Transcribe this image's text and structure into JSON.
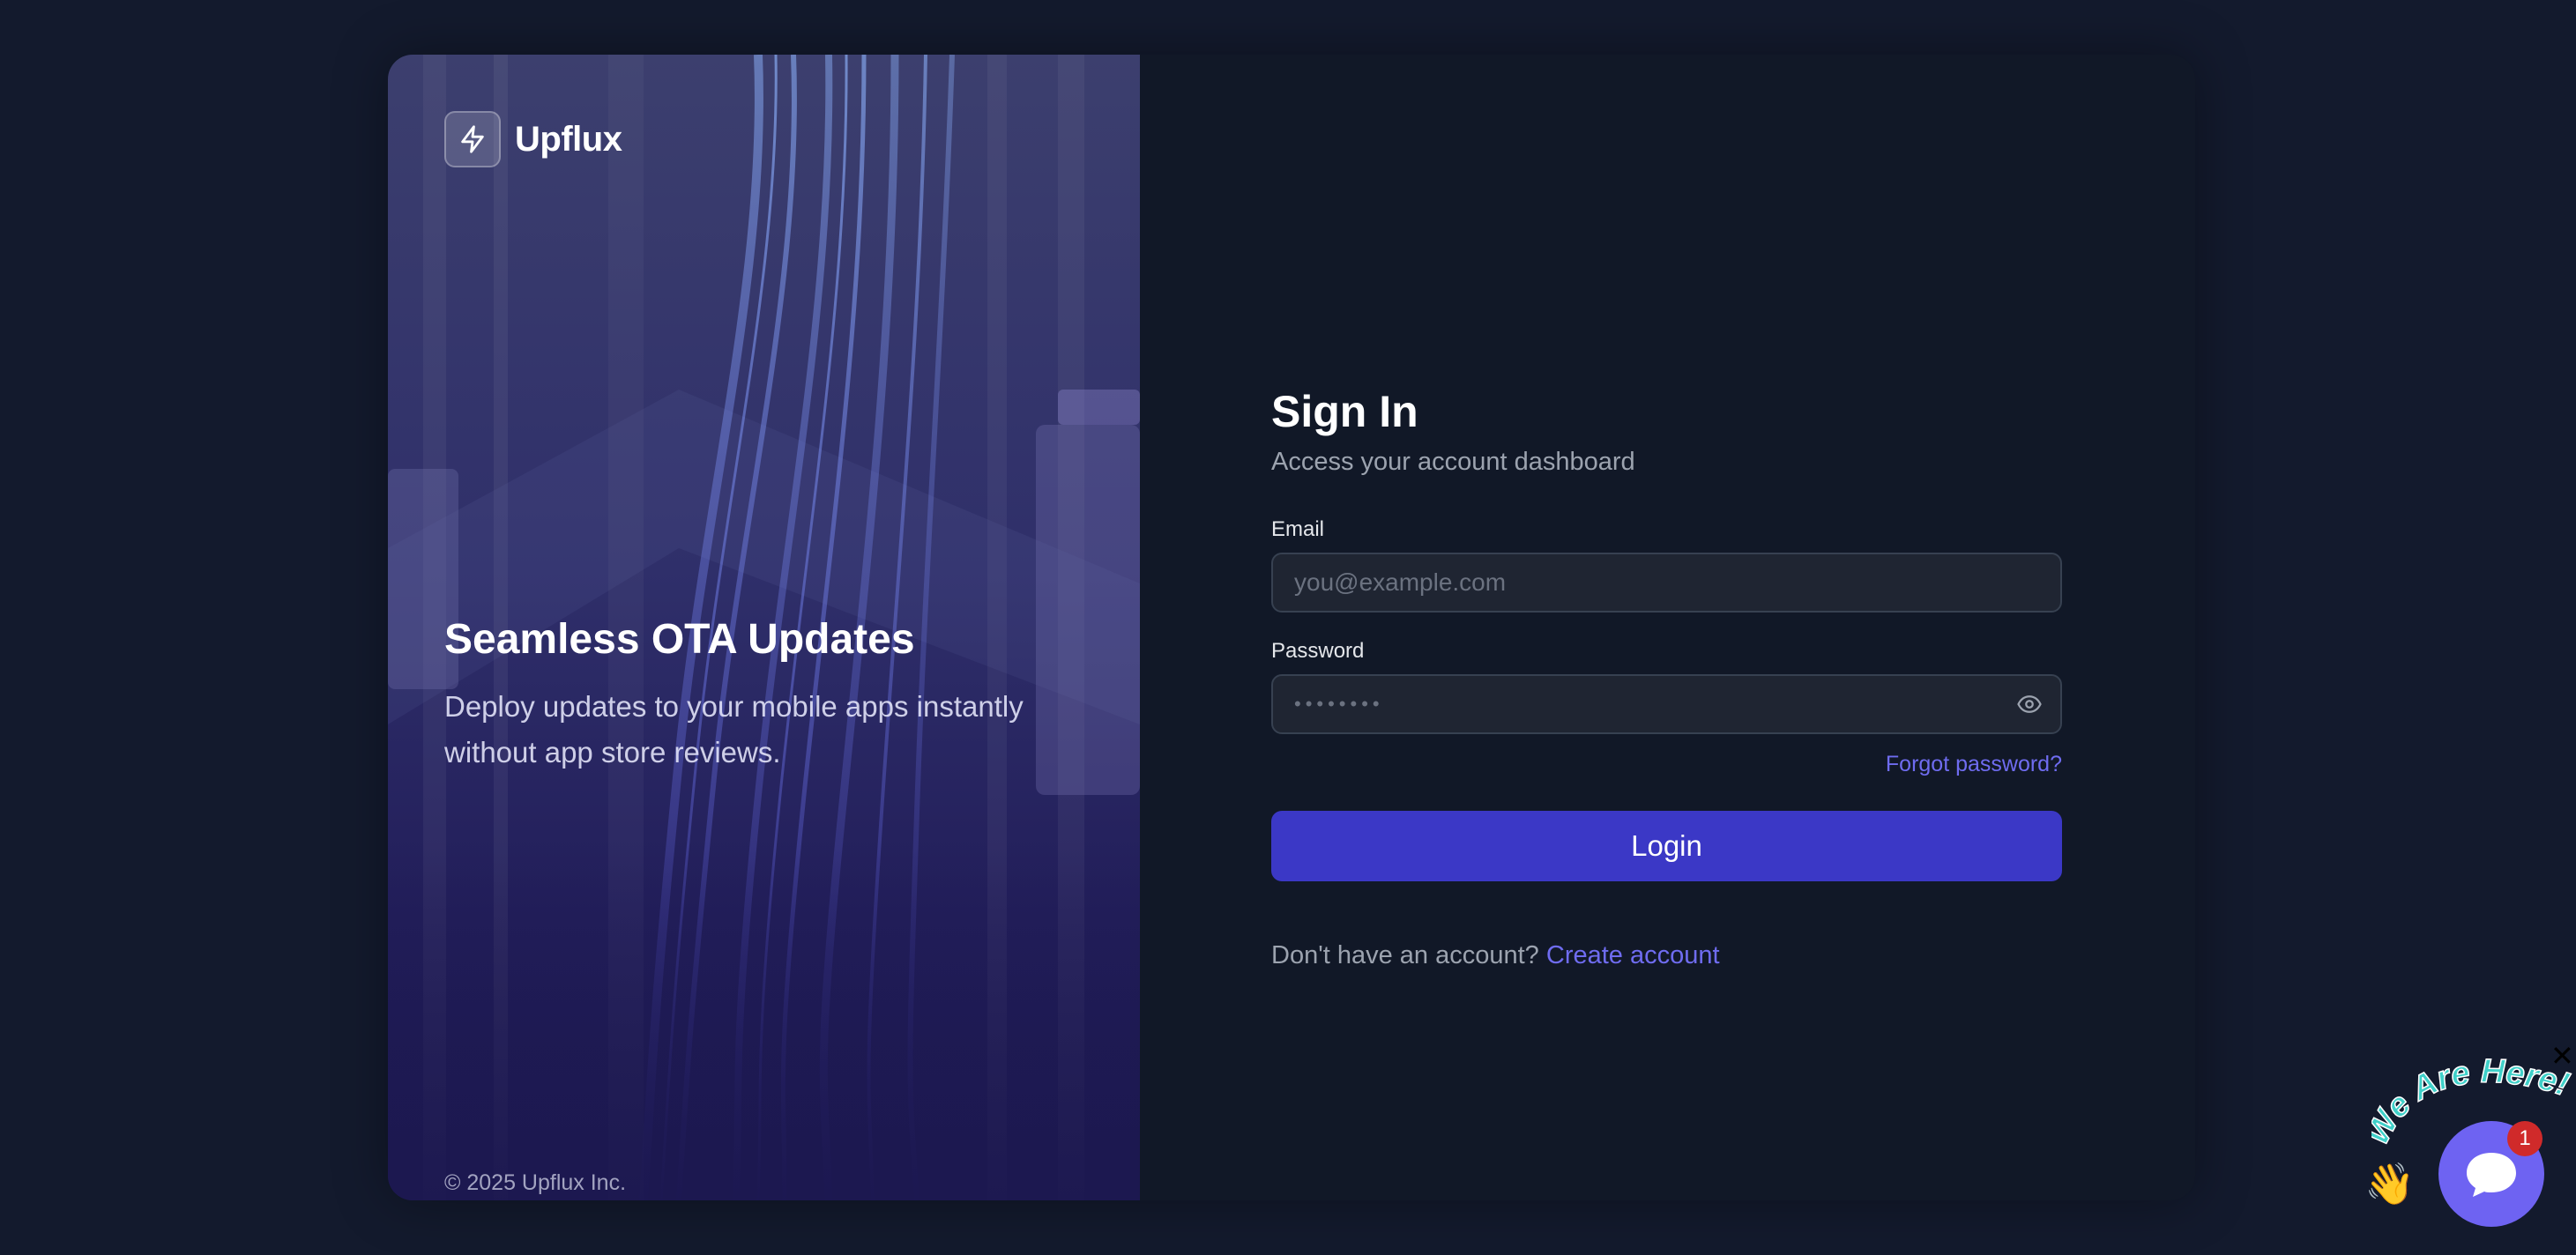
{
  "brand": {
    "name": "Upflux",
    "logo_icon": "lightning-bolt-icon"
  },
  "hero": {
    "title": "Seamless OTA Updates",
    "description": "Deploy updates to your mobile apps instantly without app store reviews.",
    "copyright": "© 2025 Upflux Inc."
  },
  "form": {
    "title": "Sign In",
    "subtitle": "Access your account dashboard",
    "email": {
      "label": "Email",
      "placeholder": "you@example.com",
      "value": ""
    },
    "password": {
      "label": "Password",
      "masked_value": "••••••••",
      "toggle_icon": "eye-icon"
    },
    "forgot_link": "Forgot password?",
    "login_label": "Login",
    "signup_prompt": "Don't have an account?",
    "signup_link": "Create account"
  },
  "chat_widget": {
    "banner_text": "We Are Here!",
    "badge_count": "1",
    "close_label": "✕",
    "wave_emoji": "👋"
  },
  "colors": {
    "page_bg": "#131a2d",
    "card_bg": "#111827",
    "accent": "#3b38c6",
    "link": "#6f6cf0",
    "chat": "#6e63f2",
    "badge": "#d02a2a"
  }
}
